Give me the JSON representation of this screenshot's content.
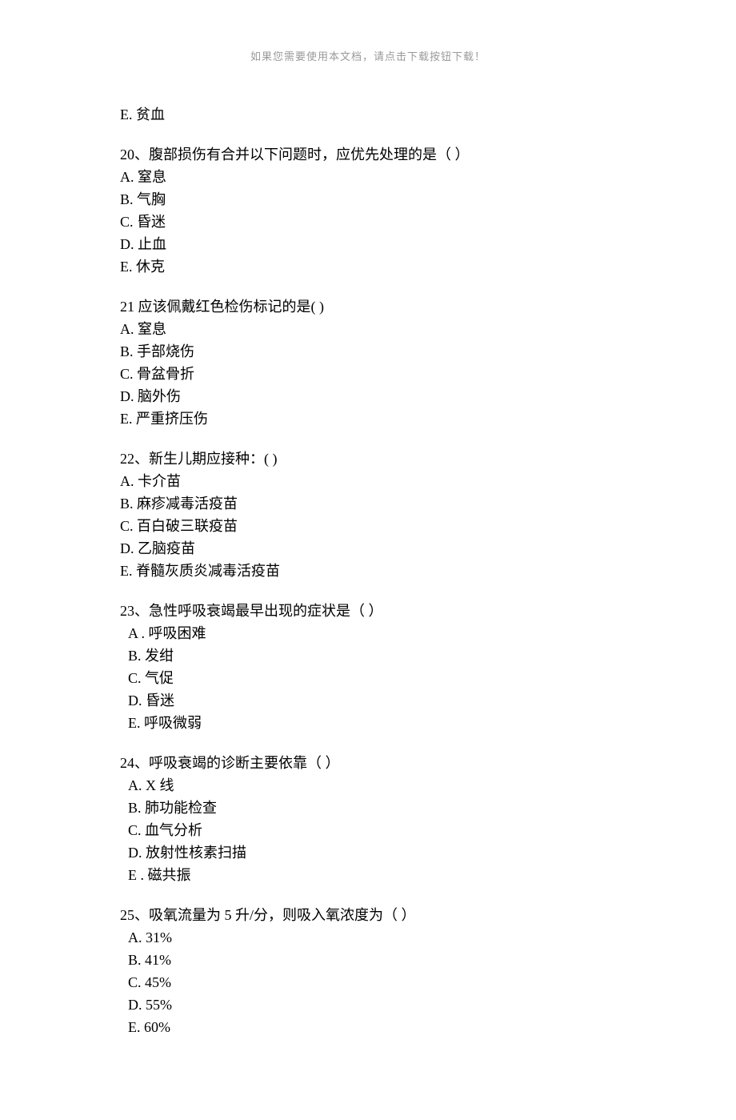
{
  "header_note": "如果您需要使用本文档，请点击下载按钮下载！",
  "orphan_option": "E.  贫血",
  "questions": [
    {
      "stem": "20、腹部损伤有合并以下问题时，应优先处理的是（ ）",
      "options": [
        {
          "t": "A.   窒息",
          "pad": "none"
        },
        {
          "t": "B. 气胸",
          "pad": "none"
        },
        {
          "t": "C. 昏迷",
          "pad": "none"
        },
        {
          "t": "D. 止血",
          "pad": "none"
        },
        {
          "t": "E. 休克",
          "pad": "none"
        }
      ]
    },
    {
      "stem": "21 应该佩戴红色检伤标记的是(  )",
      "options": [
        {
          "t": "A. 窒息",
          "pad": "none"
        },
        {
          "t": "B. 手部烧伤",
          "pad": "none"
        },
        {
          "t": "C. 骨盆骨折",
          "pad": "none"
        },
        {
          "t": "D. 脑外伤",
          "pad": "none"
        },
        {
          "t": "E. 严重挤压伤",
          "pad": "none"
        }
      ]
    },
    {
      "stem": "22、新生儿期应接种：(  )",
      "options": [
        {
          "t": "A. 卡介苗",
          "pad": "none"
        },
        {
          "t": "B. 麻疹减毒活疫苗",
          "pad": "none"
        },
        {
          "t": "C. 百白破三联疫苗",
          "pad": "none"
        },
        {
          "t": "D. 乙脑疫苗",
          "pad": "none"
        },
        {
          "t": "E. 脊髓灰质炎减毒活疫苗",
          "pad": "none"
        }
      ]
    },
    {
      "stem": "23、急性呼吸衰竭最早出现的症状是（ ）",
      "options": [
        {
          "t": "A . 呼吸困难",
          "pad": "pad1"
        },
        {
          "t": "B.  发绀",
          "pad": "pad1"
        },
        {
          "t": "C. 气促",
          "pad": "pad1"
        },
        {
          "t": "D. 昏迷",
          "pad": "pad1"
        },
        {
          "t": "E.  呼吸微弱",
          "pad": "pad1"
        }
      ]
    },
    {
      "stem": "24、呼吸衰竭的诊断主要依靠（ ）",
      "options": [
        {
          "t": "A.  X 线",
          "pad": "pad1"
        },
        {
          "t": "B.  肺功能检查",
          "pad": "pad1"
        },
        {
          "t": "C. 血气分析",
          "pad": "pad1"
        },
        {
          "t": "D.  放射性核素扫描",
          "pad": "pad1"
        },
        {
          "t": "E . 磁共振",
          "pad": "pad1"
        }
      ]
    },
    {
      "stem": "25、吸氧流量为 5 升/分，则吸入氧浓度为（ ）",
      "options": [
        {
          "t": "A. 31%",
          "pad": "pad1"
        },
        {
          "t": "B. 41%",
          "pad": "pad1"
        },
        {
          "t": "C. 45%",
          "pad": "pad1"
        },
        {
          "t": "D. 55%",
          "pad": "pad1"
        },
        {
          "t": "E. 60%",
          "pad": "pad1"
        }
      ]
    }
  ]
}
